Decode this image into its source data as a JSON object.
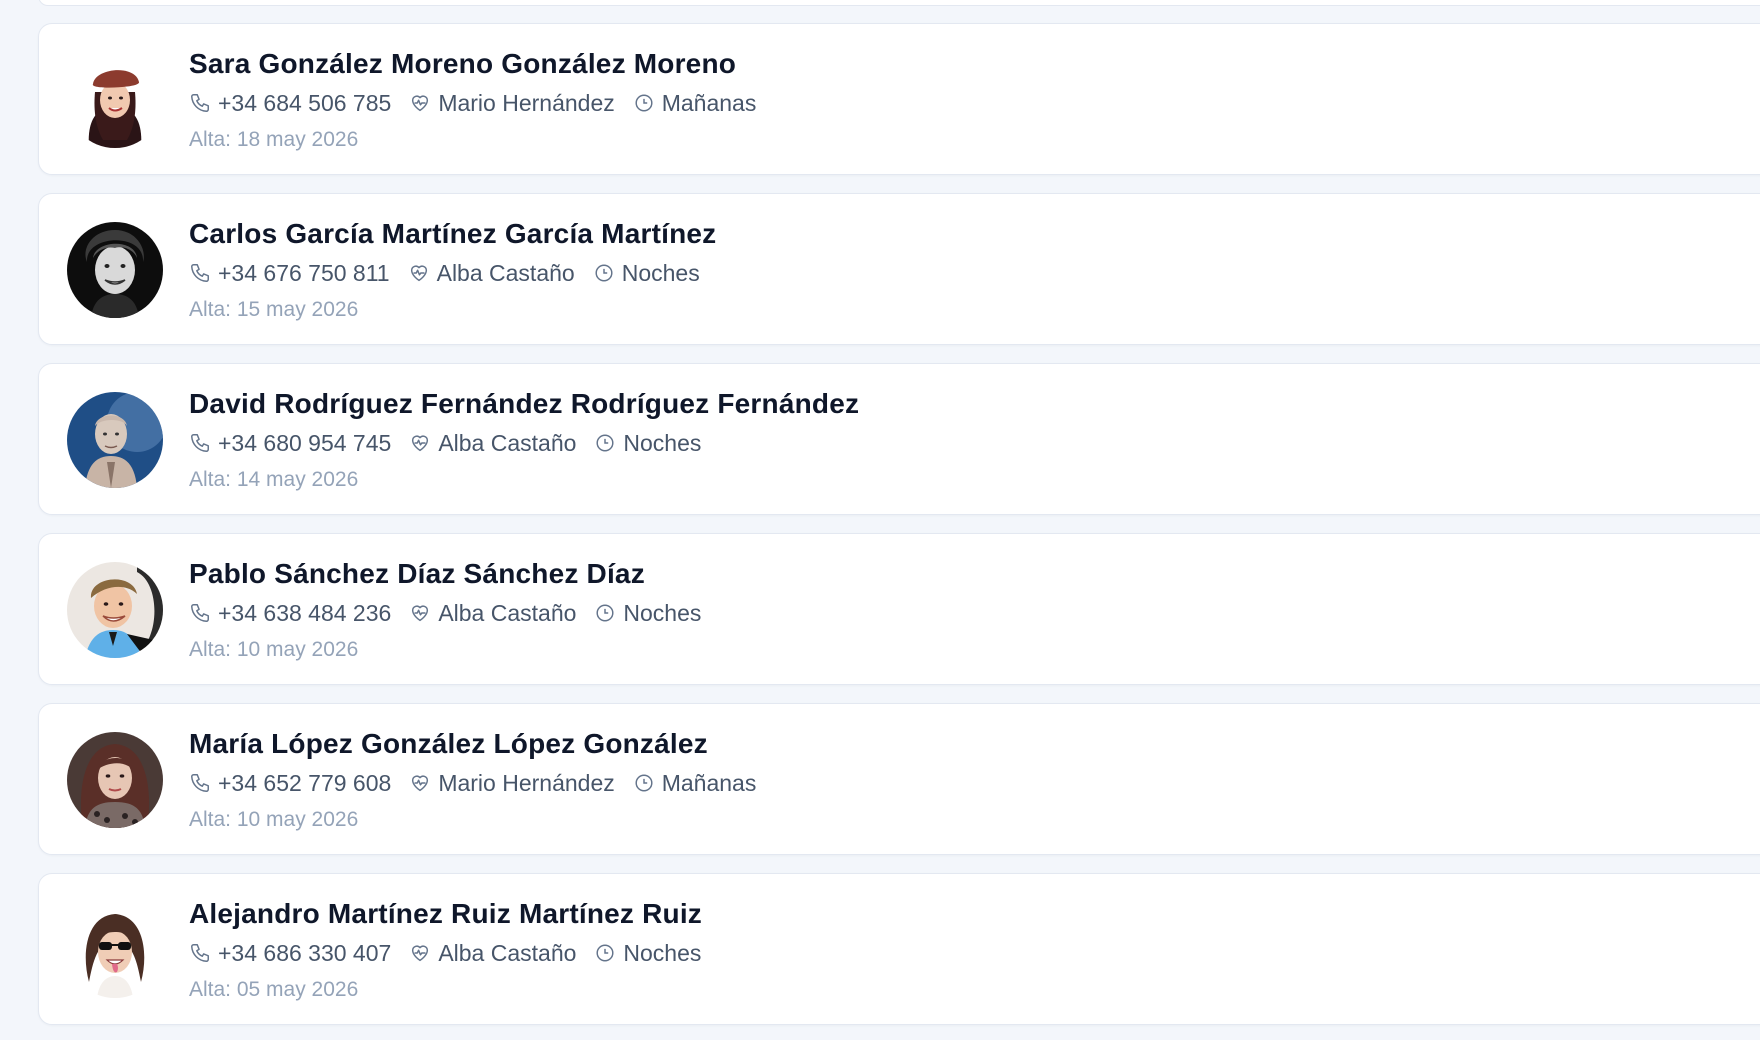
{
  "patients": [
    {
      "name": "Sara González Moreno González Moreno",
      "phone": "+34 684 506 785",
      "caregiver": "Mario Hernández",
      "shift": "Mañanas",
      "date": "Alta: 18 may 2026"
    },
    {
      "name": "Carlos García Martínez García Martínez",
      "phone": "+34 676 750 811",
      "caregiver": "Alba Castaño",
      "shift": "Noches",
      "date": "Alta: 15 may 2026"
    },
    {
      "name": "David Rodríguez Fernández Rodríguez Fernández",
      "phone": "+34 680 954 745",
      "caregiver": "Alba Castaño",
      "shift": "Noches",
      "date": "Alta: 14 may 2026"
    },
    {
      "name": "Pablo Sánchez Díaz Sánchez Díaz",
      "phone": "+34 638 484 236",
      "caregiver": "Alba Castaño",
      "shift": "Noches",
      "date": "Alta: 10 may 2026"
    },
    {
      "name": "María López González López González",
      "phone": "+34 652 779 608",
      "caregiver": "Mario Hernández",
      "shift": "Mañanas",
      "date": "Alta: 10 may 2026"
    },
    {
      "name": "Alejandro Martínez Ruiz Martínez Ruiz",
      "phone": "+34 686 330 407",
      "caregiver": "Alba Castaño",
      "shift": "Noches",
      "date": "Alta: 05 may 2026"
    }
  ],
  "icons": {
    "phone": "phone-icon",
    "caregiver": "heart-pulse-icon",
    "shift": "clock-icon"
  },
  "colors": {
    "background": "#f3f6fb",
    "card": "#ffffff",
    "name": "#0f172a",
    "meta": "#475569",
    "date": "#94a3b8"
  }
}
